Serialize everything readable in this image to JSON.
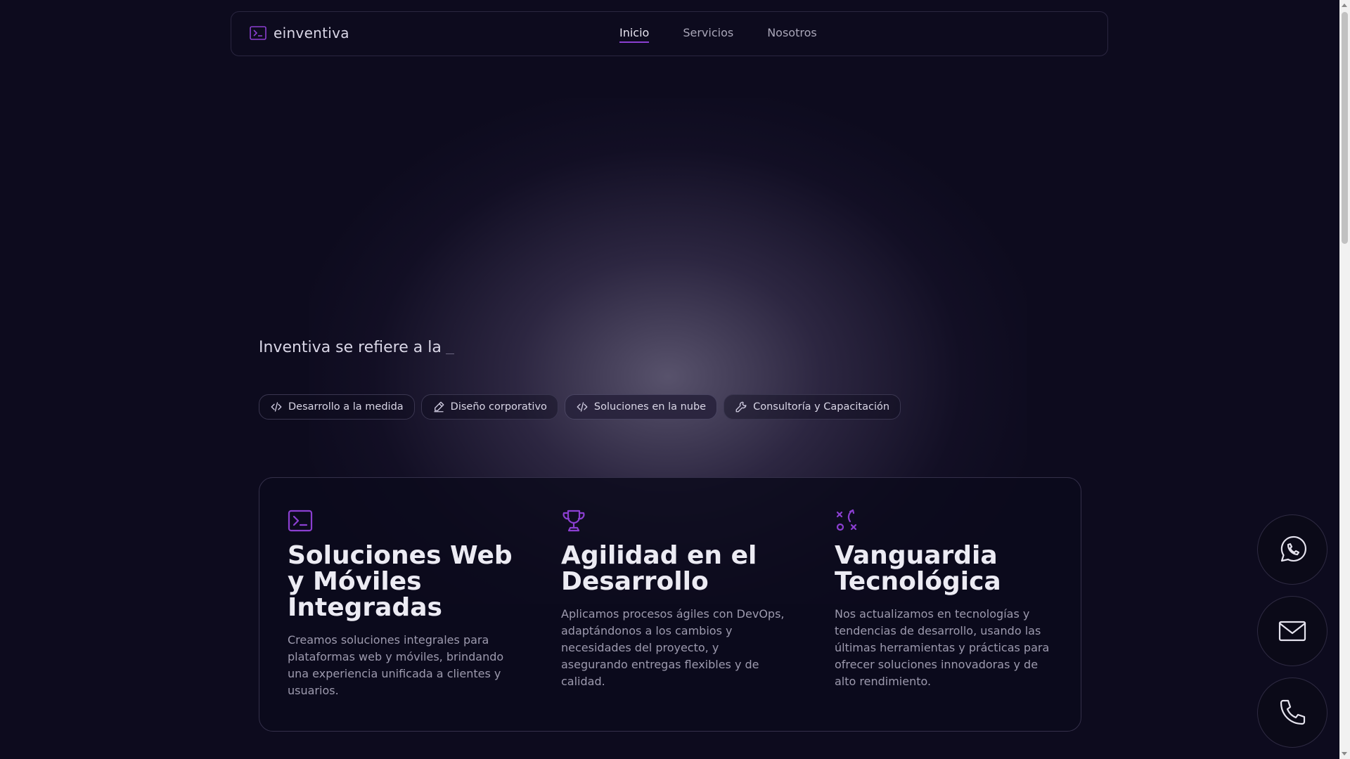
{
  "nav": {
    "brand": "einventiva",
    "links": [
      "Inicio",
      "Servicios",
      "Nosotros"
    ]
  },
  "hero": {
    "lead": "Inventiva se refiere a la"
  },
  "chips": [
    {
      "label": "Desarrollo a la medida",
      "icon": "code-icon"
    },
    {
      "label": "Diseño corporativo",
      "icon": "pen-icon"
    },
    {
      "label": "Soluciones en la nube",
      "icon": "code-icon"
    },
    {
      "label": "Consultoría y Capacitación",
      "icon": "wrench-icon"
    }
  ],
  "features": [
    {
      "icon": "terminal-icon",
      "title": "Soluciones Web y Móviles Integradas",
      "text": "Creamos soluciones integrales para plataformas web y móviles, brindando una experiencia unificada a clientes y usuarios."
    },
    {
      "icon": "trophy-icon",
      "title": "Agilidad en el Desarrollo",
      "text": "Aplicamos procesos ágiles con DevOps, adaptándonos a los cambios y necesidades del proyecto, y asegurando entregas flexibles y de calidad."
    },
    {
      "icon": "strategy-icon",
      "title": "Vanguardia Tecnológica",
      "text": "Nos actualizamos en tecnologías y tendencias de desarrollo, usando las últimas herramientas y prácticas para ofrecer soluciones innovadoras y de alto rendimiento."
    }
  ],
  "contacts": [
    "whatsapp-icon",
    "mail-icon",
    "phone-icon"
  ],
  "colors": {
    "accent": "#8b3fd1",
    "background": "#0d0b1e",
    "muted_text": "#9d9aae"
  }
}
